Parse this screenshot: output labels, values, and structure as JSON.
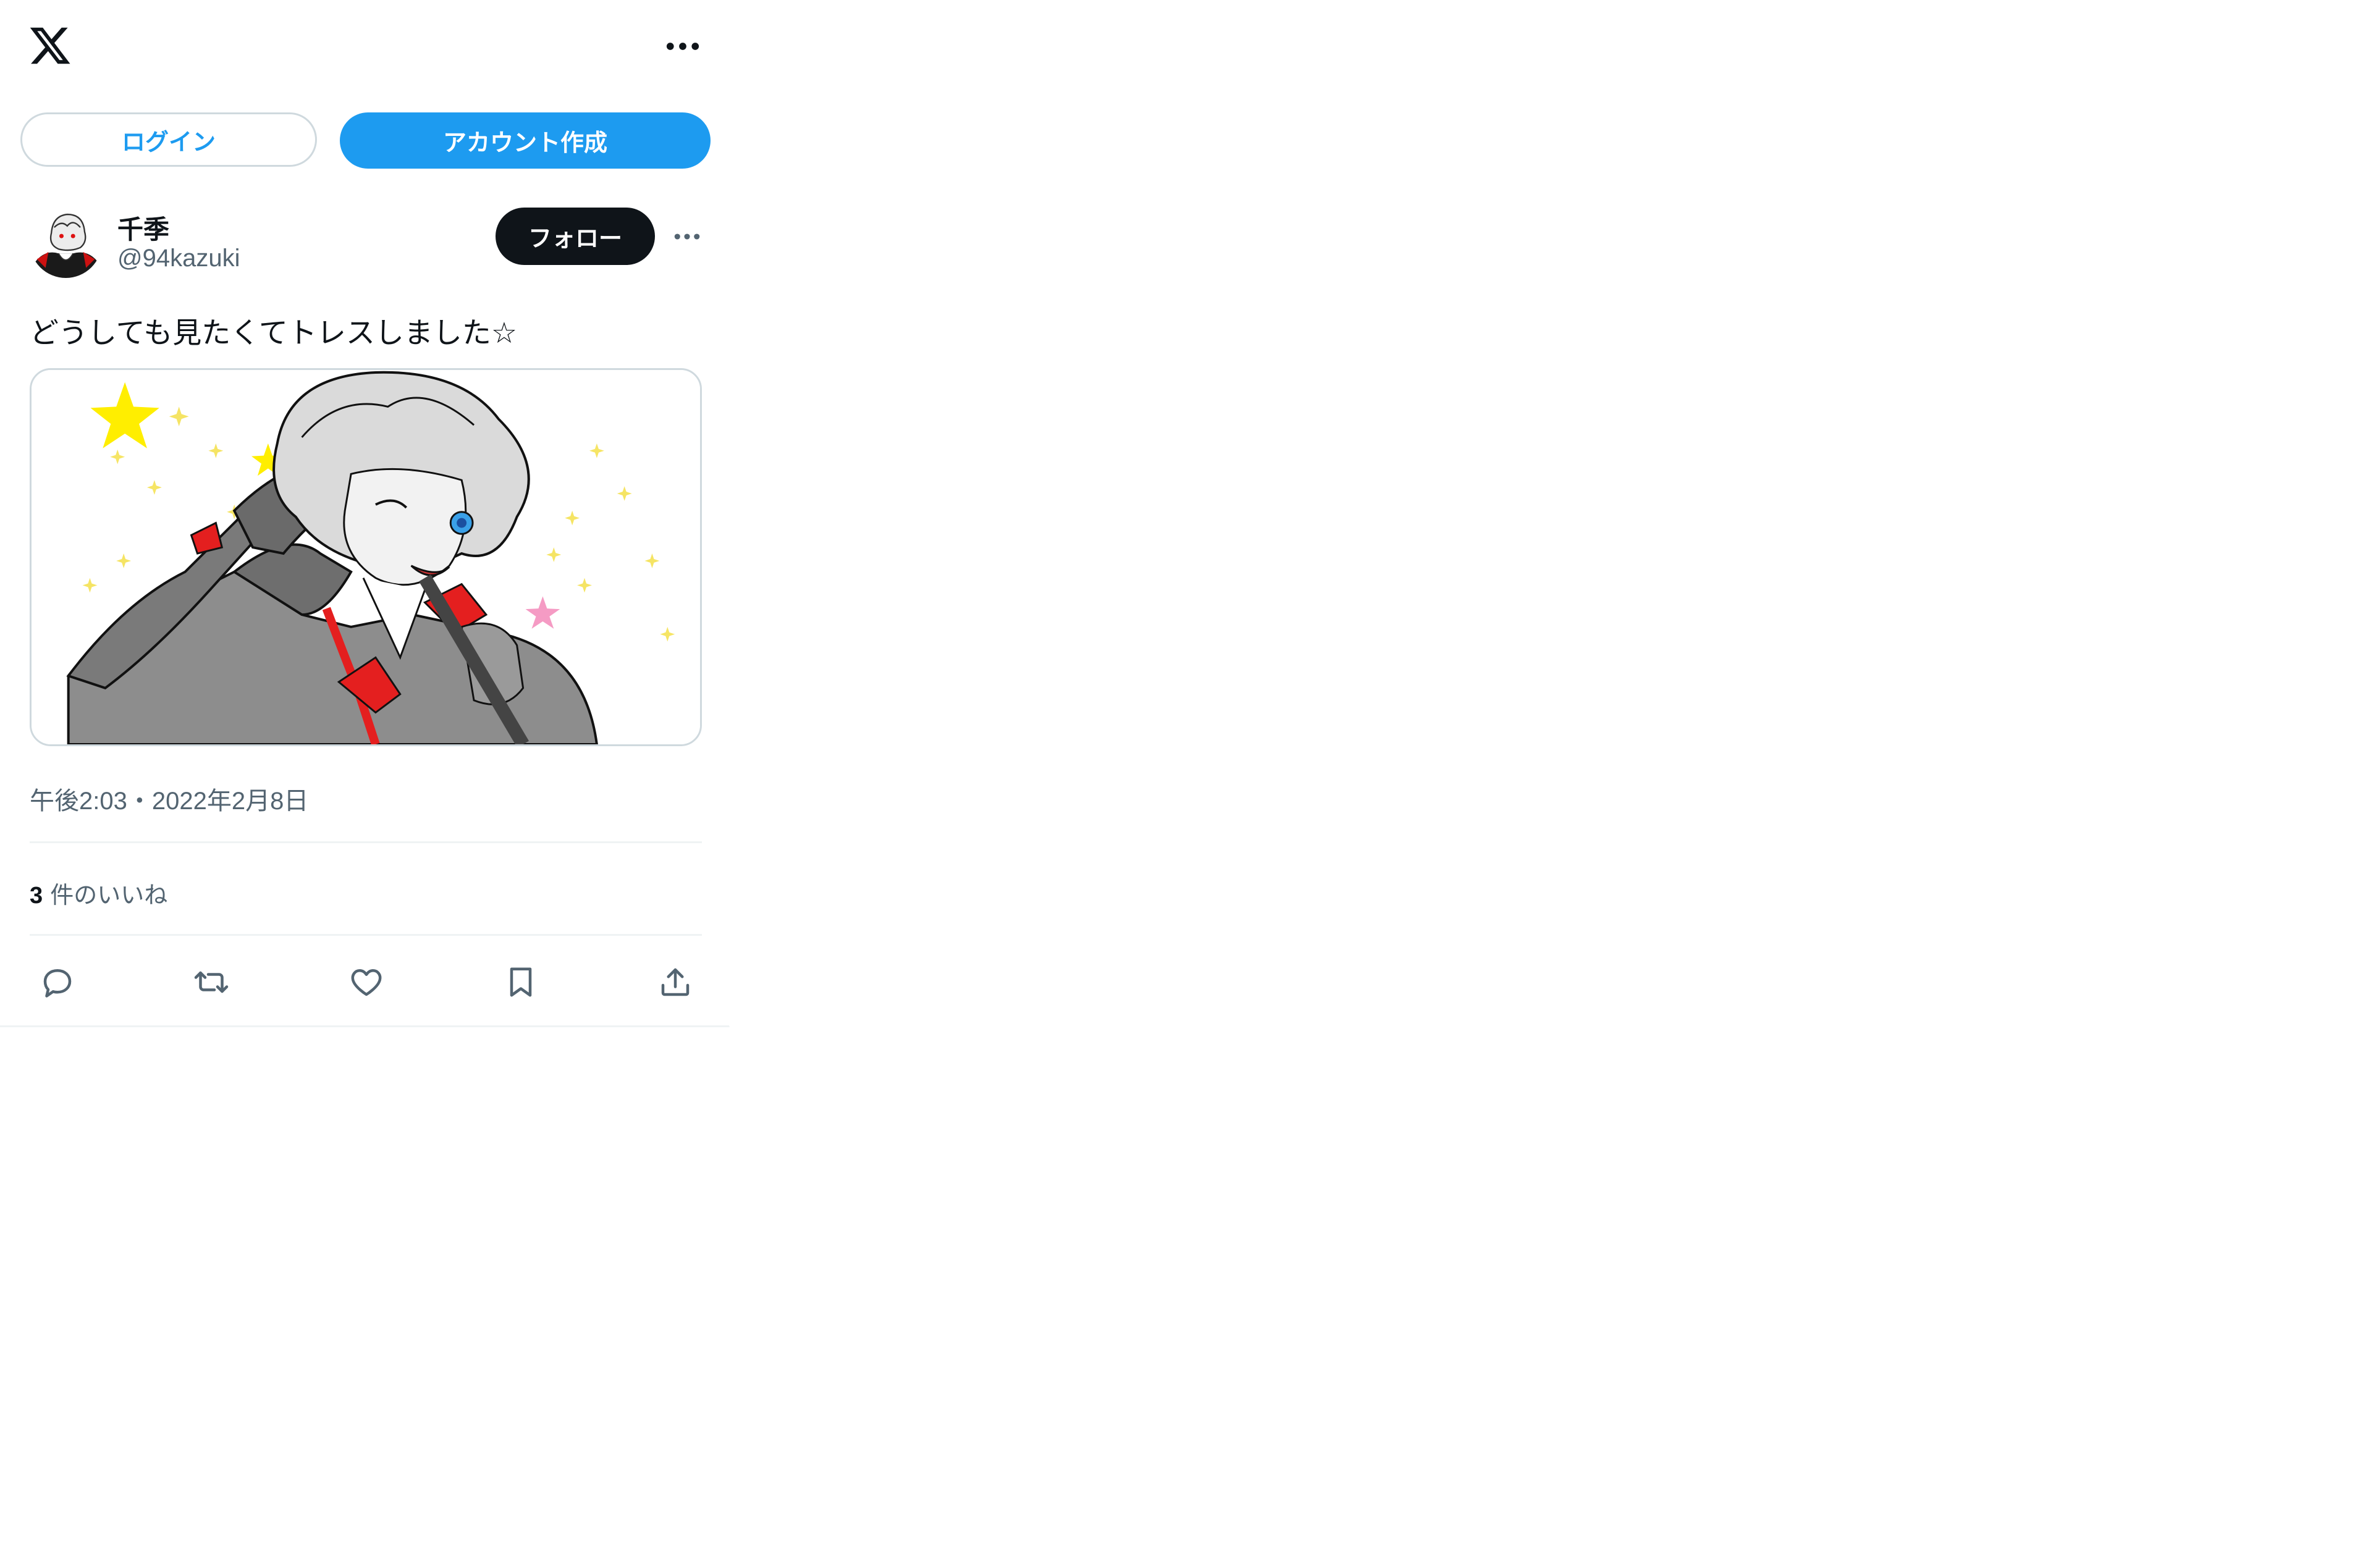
{
  "header": {
    "logo_icon": "x-logo-icon",
    "more_icon": "more-horizontal-icon"
  },
  "auth": {
    "login_label": "ログイン",
    "signup_label": "アカウント作成"
  },
  "post": {
    "author": {
      "display_name": "千季",
      "handle": "@94kazuki",
      "follow_label": "フォロー"
    },
    "text": "どうしても見たくてトレスしました☆",
    "timestamp": "午後2:03・2022年2月8日",
    "likes": {
      "count": "3",
      "label": "件のいいね"
    },
    "actions": [
      "reply-icon",
      "retweet-icon",
      "like-icon",
      "bookmark-icon",
      "share-icon"
    ]
  },
  "colors": {
    "accent": "#1d9bf0",
    "text_primary": "#0f1419",
    "text_secondary": "#536471",
    "border": "#cfd9de",
    "divider": "#eff3f4"
  }
}
